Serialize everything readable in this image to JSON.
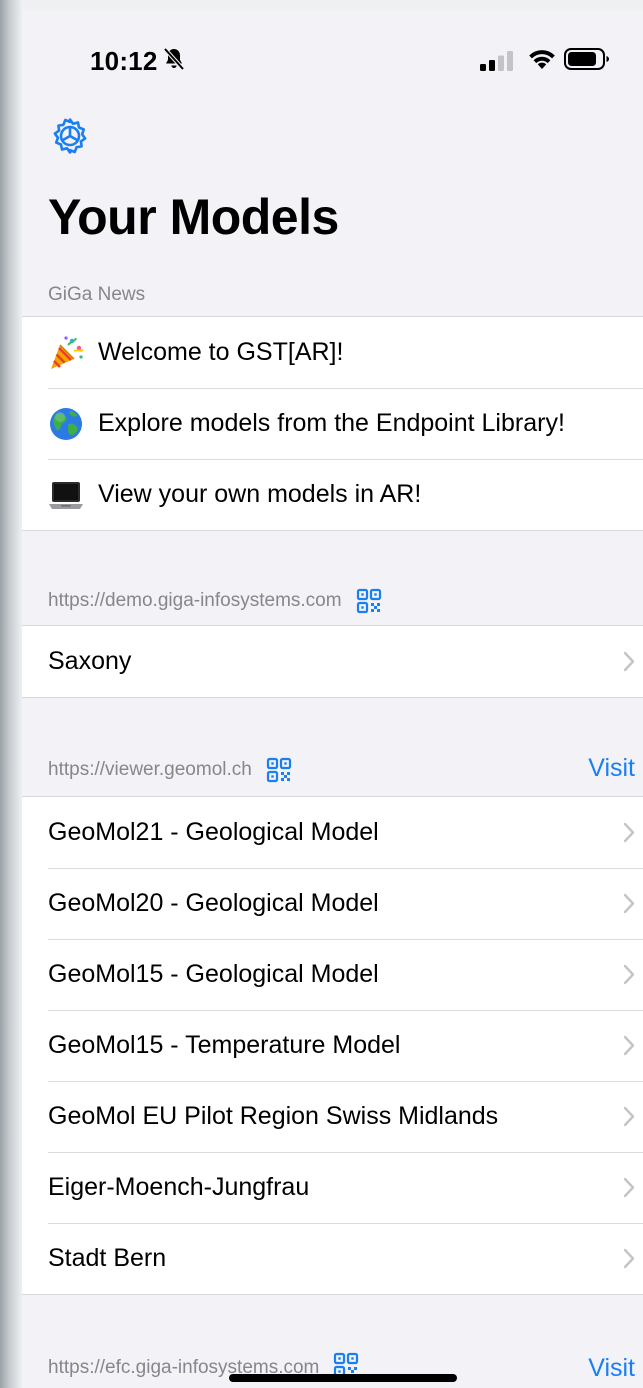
{
  "status_bar": {
    "time": "10:12"
  },
  "page": {
    "title": "Your Models"
  },
  "news": {
    "header": "GiGa News",
    "items": [
      {
        "icon": "party-popper-icon",
        "label": "Welcome to GST[AR]!"
      },
      {
        "icon": "globe-icon",
        "label": "Explore models from the Endpoint Library!"
      },
      {
        "icon": "laptop-icon",
        "label": "View your own models in AR!"
      }
    ]
  },
  "endpoints": [
    {
      "url": "https://demo.giga-infosystems.com",
      "visit_label": "",
      "models": [
        "Saxony"
      ]
    },
    {
      "url": "https://viewer.geomol.ch",
      "visit_label": "Visit",
      "models": [
        "GeoMol21 - Geological Model",
        "GeoMol20 - Geological Model",
        "GeoMol15 - Geological Model",
        "GeoMol15 - Temperature Model",
        "GeoMol EU Pilot Region Swiss Midlands",
        "Eiger-Moench-Jungfrau",
        "Stadt Bern"
      ]
    },
    {
      "url": "https://efc.giga-infosystems.com",
      "visit_label": "Visit",
      "models": []
    }
  ],
  "colors": {
    "accent": "#1a7ff2",
    "background": "#f2f2f7",
    "secondary_text": "#86868b"
  }
}
